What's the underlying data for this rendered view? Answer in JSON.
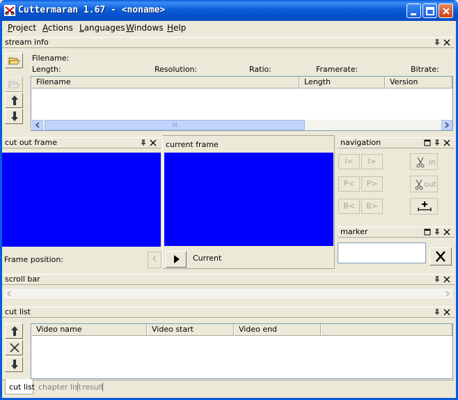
{
  "window": {
    "title": "Cuttermaran 1.67 - <noname>"
  },
  "menu": {
    "items": [
      {
        "first": "P",
        "rest": "roject"
      },
      {
        "first": "A",
        "rest": "ctions"
      },
      {
        "first": "L",
        "rest": "anguages"
      },
      {
        "first": "W",
        "rest": "indows"
      },
      {
        "first": "H",
        "rest": "elp"
      }
    ]
  },
  "stream_info": {
    "title": "stream info",
    "filename_label": "Filename:",
    "length_label": "Length:",
    "resolution_label": "Resolution:",
    "ratio_label": "Ratio:",
    "framerate_label": "Framerate:",
    "bitrate_label": "Bitrate:",
    "columns": [
      "Filename",
      "Length",
      "Version"
    ],
    "scroll_thumb_grip": "III"
  },
  "cut_out_frame": {
    "title": "cut out frame",
    "frame_position_label": "Frame position:"
  },
  "current_frame": {
    "title": "current frame",
    "current_label": "Current"
  },
  "navigation": {
    "title": "navigation",
    "buttons": [
      "I<",
      "I>",
      "P<",
      "P>",
      "B<",
      "B>"
    ],
    "cut_in_label": "in",
    "cut_out_label": "out"
  },
  "marker": {
    "title": "marker",
    "value": ""
  },
  "scroll_bar": {
    "title": "scroll bar"
  },
  "cut_list": {
    "title": "cut list",
    "columns": [
      "Video name",
      "Video start",
      "Video end"
    ]
  },
  "tabs": [
    "cut list",
    "chapter list",
    "result"
  ],
  "colors": {
    "titlebar": "#0a5bd9",
    "face": "#ece9d8",
    "video": "#0000ff"
  }
}
